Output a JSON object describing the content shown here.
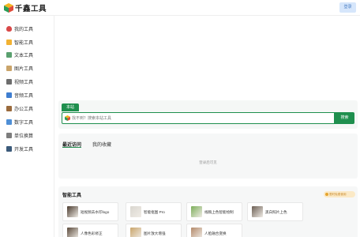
{
  "header": {
    "brand": "千鑫工具",
    "login_label": "登录"
  },
  "sidebar": {
    "items": [
      {
        "label": "我的工具",
        "icon": "heart-icon",
        "color": "#d94848"
      },
      {
        "label": "智能工具",
        "icon": "sparkle-icon",
        "color": "#f2b233"
      },
      {
        "label": "文本工具",
        "icon": "document-icon",
        "color": "#5aa06f"
      },
      {
        "label": "图片工具",
        "icon": "picture-icon",
        "color": "#caa46a"
      },
      {
        "label": "视频工具",
        "icon": "film-icon",
        "color": "#6d6d6d"
      },
      {
        "label": "音频工具",
        "icon": "music-note-icon",
        "color": "#3f7ed0"
      },
      {
        "label": "办公工具",
        "icon": "briefcase-icon",
        "color": "#9a6a3c"
      },
      {
        "label": "数字工具",
        "icon": "number-keycap-icon",
        "color": "#4f8fd6"
      },
      {
        "label": "单位换算",
        "icon": "calculator-icon",
        "color": "#7d7d7d"
      },
      {
        "label": "开发工具",
        "icon": "monitor-icon",
        "color": "#3b5a7a"
      }
    ]
  },
  "search": {
    "tab_label": "本站",
    "placeholder": "找不到？搜索本站工具",
    "button_label": "搜索"
  },
  "recent": {
    "tabs": [
      "最近访问",
      "我的收藏"
    ],
    "empty_text": "登录后可见"
  },
  "smart_tools": {
    "title": "智能工具",
    "badge": "限时免费使用",
    "cards": [
      {
        "label": "短视频去水印logo",
        "icon": "video-watermark-icon",
        "color": "#4a3b2e"
      },
      {
        "label": "智能抠图 Pro",
        "icon": "cutout-icon",
        "color": "#d9d6cf"
      },
      {
        "label": "线稿上色智能绘制",
        "icon": "line-art-icon",
        "color": "#7cae5a"
      },
      {
        "label": "黑白照片上色",
        "icon": "photo-colorize-icon",
        "color": "#6b5e53"
      },
      {
        "label": "人像色彩修正",
        "icon": "portrait-icon",
        "color": "#5a4a3b"
      },
      {
        "label": "图片放大增强",
        "icon": "image-enlarge-icon",
        "color": "#c9a46a"
      },
      {
        "label": "人脸融合变换",
        "icon": "face-swap-icon",
        "color": "#b48a6a"
      }
    ]
  }
}
